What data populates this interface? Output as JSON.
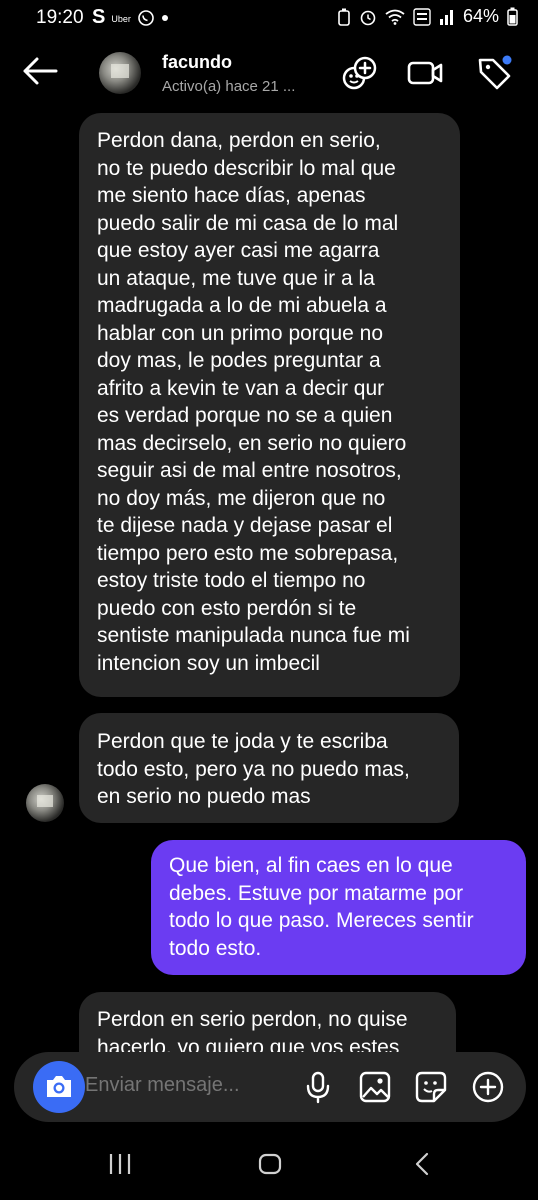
{
  "status_bar": {
    "time": "19:20",
    "app_icons": [
      "S",
      "Uber"
    ],
    "battery": "64%"
  },
  "header": {
    "name": "facundo",
    "status": "Activo(a) hace 21 ..."
  },
  "messages": [
    {
      "side": "received",
      "lines": [
        "Perdon dana, perdon en serio,",
        "no te puedo describir lo mal que",
        "me siento hace días, apenas",
        "puedo salir de mi casa de lo mal",
        "que estoy ayer casi me agarra",
        "un ataque, me tuve que ir a la",
        "madrugada a lo de mi abuela a",
        "hablar con un primo porque no",
        "doy mas, le podes preguntar a",
        "afrito a kevin te van a decir qur",
        "es verdad porque no se a quien",
        "mas decirselo, en serio no quiero",
        "seguir asi de mal entre nosotros,",
        "no doy más, me dijeron que no",
        "te dijese nada y dejase pasar el",
        "tiempo pero esto me sobrepasa,",
        "estoy triste todo el tiempo no",
        "puedo con esto perdón si te",
        "sentiste manipulada nunca fue mi",
        "intencion soy un imbecil"
      ]
    },
    {
      "side": "received",
      "lines": [
        "Perdon que te joda y te escriba",
        "todo esto, pero ya no puedo mas,",
        "en serio no puedo mas"
      ]
    },
    {
      "side": "sent",
      "lines": [
        "Que bien, al fin caes en lo que",
        "debes. Estuve por matarme por",
        "todo lo que paso. Mereces sentir",
        "todo esto."
      ]
    },
    {
      "side": "received",
      "lines": [
        "Perdon en serio perdon, no quise",
        "hacerlo, yo quiero que vos estes"
      ]
    }
  ],
  "composer": {
    "placeholder": "Enviar mensaje..."
  },
  "colors": {
    "background": "#000000",
    "received_bubble": "#262626",
    "sent_bubble": "#6b3cf2",
    "camera_button": "#3a6cf5",
    "notification_dot": "#3d7bf7"
  }
}
